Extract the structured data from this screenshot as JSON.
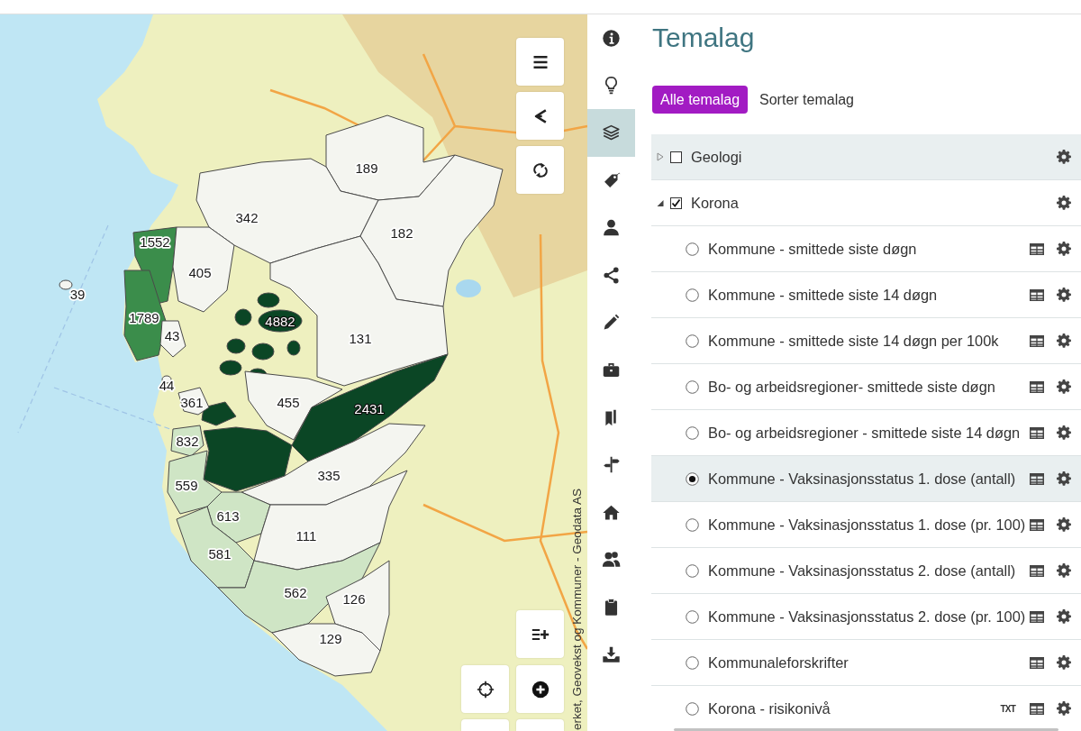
{
  "map": {
    "regions": [
      {
        "label": "189",
        "color": "#f4f5f0"
      },
      {
        "label": "342",
        "color": "#f4f5f0"
      },
      {
        "label": "182",
        "color": "#f4f5f0"
      },
      {
        "label": "1552",
        "color": "#3b8d4b"
      },
      {
        "label": "405",
        "color": "#f4f5f0"
      },
      {
        "label": "39",
        "color": "#f4f5f0"
      },
      {
        "label": "4882",
        "color": "#0b4625"
      },
      {
        "label": "1789",
        "color": "#3b8d4b"
      },
      {
        "label": "131",
        "color": "#f4f5f0"
      },
      {
        "label": "43",
        "color": "#f4f5f0"
      },
      {
        "label": "44",
        "color": "#f4f5f0"
      },
      {
        "label": "361",
        "color": "#f4f5f0"
      },
      {
        "label": "455",
        "color": "#f4f5f0"
      },
      {
        "label": "2431",
        "color": "#0b4625"
      },
      {
        "label": "832",
        "color": "#cfe5c5"
      },
      {
        "label": "335",
        "color": "#f4f5f0"
      },
      {
        "label": "559",
        "color": "#cfe5c5"
      },
      {
        "label": "613",
        "color": "#cfe5c5"
      },
      {
        "label": "111",
        "color": "#f4f5f0"
      },
      {
        "label": "581",
        "color": "#cfe5c5"
      },
      {
        "label": "562",
        "color": "#cfe5c5"
      },
      {
        "label": "126",
        "color": "#f4f5f0"
      },
      {
        "label": "129",
        "color": "#f4f5f0"
      }
    ],
    "attribution": "erket, Geovekst og Kommuner - Geodata AS"
  },
  "sidebar": {
    "items": [
      {
        "selected": false
      },
      {
        "selected": false
      },
      {
        "selected": true
      },
      {
        "selected": false
      },
      {
        "selected": false
      },
      {
        "selected": false
      },
      {
        "selected": false
      },
      {
        "selected": false
      },
      {
        "selected": false
      },
      {
        "selected": false
      },
      {
        "selected": false
      },
      {
        "selected": false
      },
      {
        "selected": false
      },
      {
        "selected": false
      }
    ]
  },
  "panel": {
    "title": "Temalag",
    "tabs": [
      {
        "label": "Alle temalag",
        "selected": true
      },
      {
        "label": "Sorter temalag",
        "selected": false
      }
    ],
    "groups": [
      {
        "label": "Geologi",
        "highlighted": true,
        "checked": false,
        "expanded": false
      },
      {
        "label": "Korona",
        "highlighted": false,
        "checked": true,
        "expanded": true,
        "children": [
          {
            "label": "Kommune - smittede siste døgn",
            "selected": false
          },
          {
            "label": "Kommune - smittede siste 14 døgn",
            "selected": false
          },
          {
            "label": "Kommune - smittede siste 14 døgn per 100k",
            "selected": false
          },
          {
            "label": "Bo- og arbeidsregioner- smittede siste døgn",
            "selected": false
          },
          {
            "label": "Bo- og arbeidsregioner - smittede siste 14 døgn",
            "selected": false
          },
          {
            "label": "Kommune - Vaksinasjonsstatus 1. dose (antall)",
            "selected": true
          },
          {
            "label": "Kommune - Vaksinasjonsstatus 1. dose (pr. 100)",
            "selected": false
          },
          {
            "label": "Kommune - Vaksinasjonsstatus 2. dose (antall)",
            "selected": false
          },
          {
            "label": "Kommune - Vaksinasjonsstatus 2. dose (pr. 100)",
            "selected": false
          },
          {
            "label": "Kommunaleforskrifter",
            "selected": false
          },
          {
            "label": "Korona - risikonivå",
            "selected": false,
            "format": "TXT"
          }
        ]
      }
    ]
  }
}
